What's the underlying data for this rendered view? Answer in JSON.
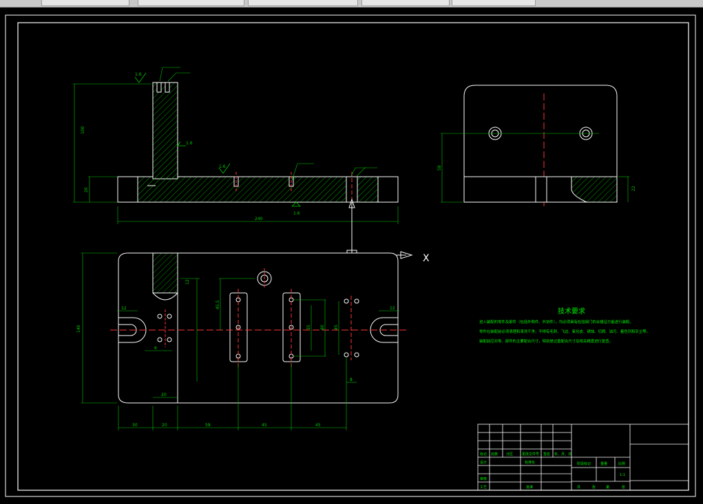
{
  "tabs": [
    {
      "label": ""
    },
    {
      "label": ""
    },
    {
      "label": ""
    },
    {
      "label": ""
    },
    {
      "label": ""
    }
  ],
  "dims": {
    "front_height": "100",
    "front_base_height": "20",
    "front_width": "240",
    "side_height": "58",
    "side_base": "22",
    "plan_height": "140",
    "plan_b1": "30",
    "plan_b2": "20",
    "plan_b3": "58",
    "plan_b4": "45",
    "plan_b5": "45",
    "plan_top_left": "12",
    "plan_top_right": "12",
    "plan_v1": "45.5",
    "plan_v2": "80",
    "plan_v3": "35",
    "plan_v4": "45",
    "plan_small": "8",
    "plan_small2": "12",
    "plan_bottom_left": "6",
    "plan_bottom_small": "20",
    "rough_1": "1.6",
    "rough_2": "1.6",
    "rough_3": "1.6",
    "rough_4": "1.6"
  },
  "axis_label": "X",
  "tech": {
    "title": "技术要求",
    "line1": "进入装配的零件及部件（包括外购件、外协件），均必须具有检验部门的合格证方能进行装配。",
    "line2": "零件在装配前必须清理和清洗干净，不得有毛刺、飞边、氧化皮、锈蚀、切屑、油污、着色剂和灰尘等。",
    "line3": "装配前应对零、部件的主要配合尺寸，特别是过盈配合尺寸及相关精度进行复查。"
  },
  "titleblock": {
    "r1": [
      "标记",
      "处数",
      "分区",
      "更改文件号",
      "签名",
      "年、月、日"
    ],
    "r2a": "设计",
    "r2b": "标准化",
    "stage": "阶段标记",
    "weight": "重量",
    "scale": "比例",
    "scale_val": "1:1",
    "review": "审核",
    "process": "工艺",
    "approve": "批准",
    "sheets": [
      "共",
      "张",
      "第",
      "张"
    ]
  }
}
